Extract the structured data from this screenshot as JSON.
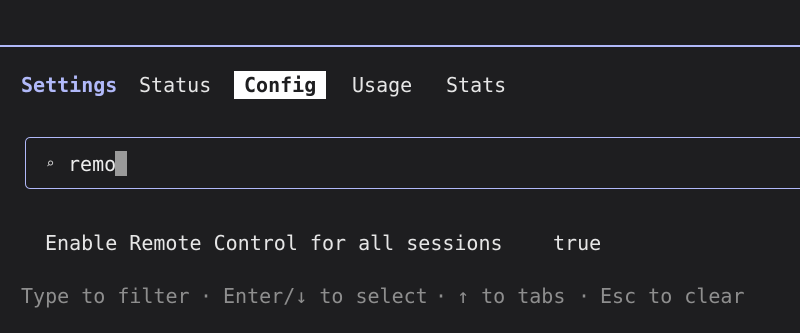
{
  "tabs": {
    "title": "Settings",
    "items": [
      "Status",
      "Config",
      "Usage",
      "Stats"
    ],
    "active": "Config"
  },
  "search": {
    "icon": "search-icon",
    "icon_glyph": "⌕",
    "value": "remo"
  },
  "settings": [
    {
      "label": "Enable Remote Control for all sessions",
      "value": "true"
    }
  ],
  "footer": {
    "hints": [
      "Type to filter",
      "Enter/↓ to select",
      "↑ to tabs",
      "Esc to clear"
    ],
    "separator": "·"
  },
  "colors": {
    "accent": "#b1b9f9",
    "background": "#1e1e20",
    "muted_text": "#8e8e8e"
  }
}
